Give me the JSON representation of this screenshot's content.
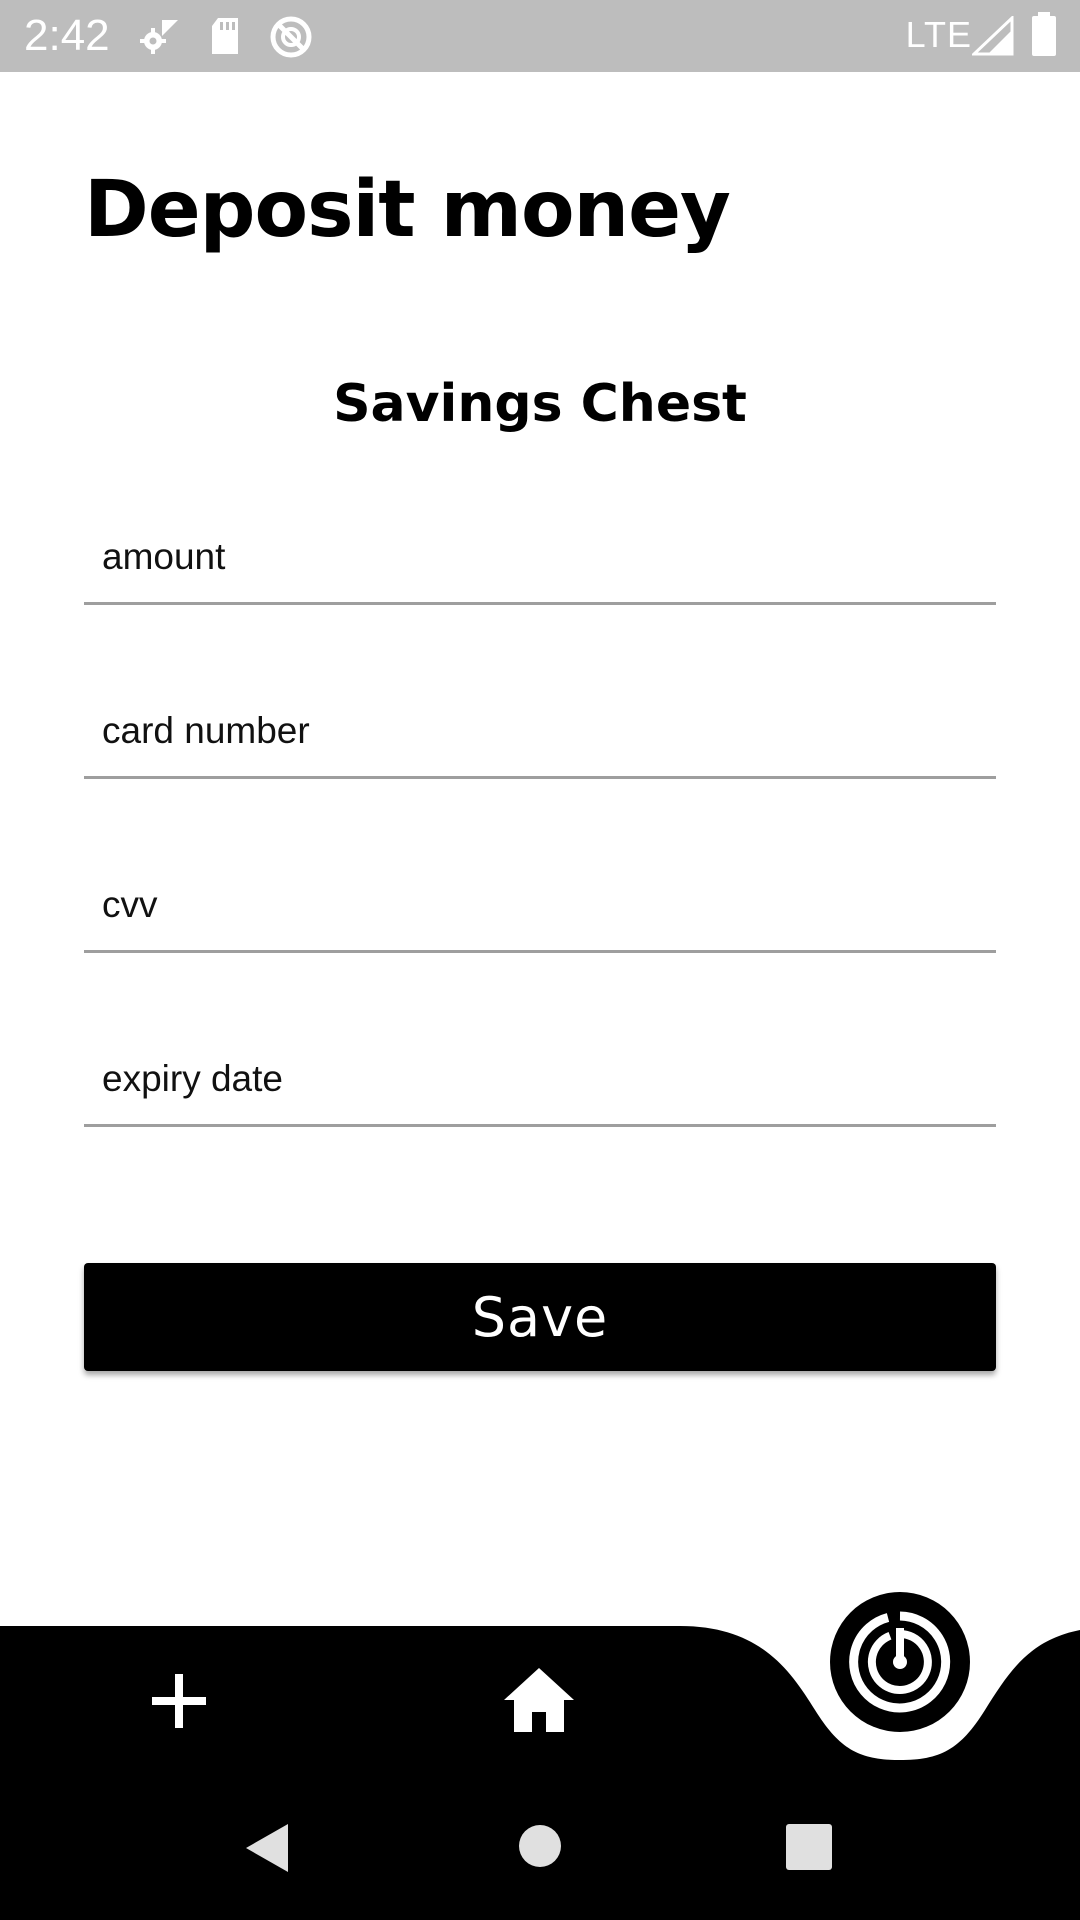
{
  "status_bar": {
    "time": "2:42",
    "network": "LTE",
    "icons": [
      "settings-icon",
      "sd-card-icon",
      "blocked-sync-icon",
      "signal-icon",
      "battery-icon"
    ]
  },
  "page": {
    "title": "Deposit money",
    "chest_name": "Savings Chest"
  },
  "form": {
    "amount_placeholder": "amount",
    "card_number_placeholder": "card number",
    "cvv_placeholder": "cvv",
    "expiry_placeholder": "expiry date",
    "save_label": "Save"
  },
  "bottom_nav": {
    "items": [
      "add-icon",
      "home-icon",
      "radar-icon"
    ]
  },
  "system_nav": {
    "items": [
      "back-icon",
      "home-circle-icon",
      "recents-icon"
    ]
  },
  "colors": {
    "status_bar": "#bdbdbd",
    "primary": "#000000",
    "background": "#ffffff",
    "divider": "#9e9e9e"
  }
}
